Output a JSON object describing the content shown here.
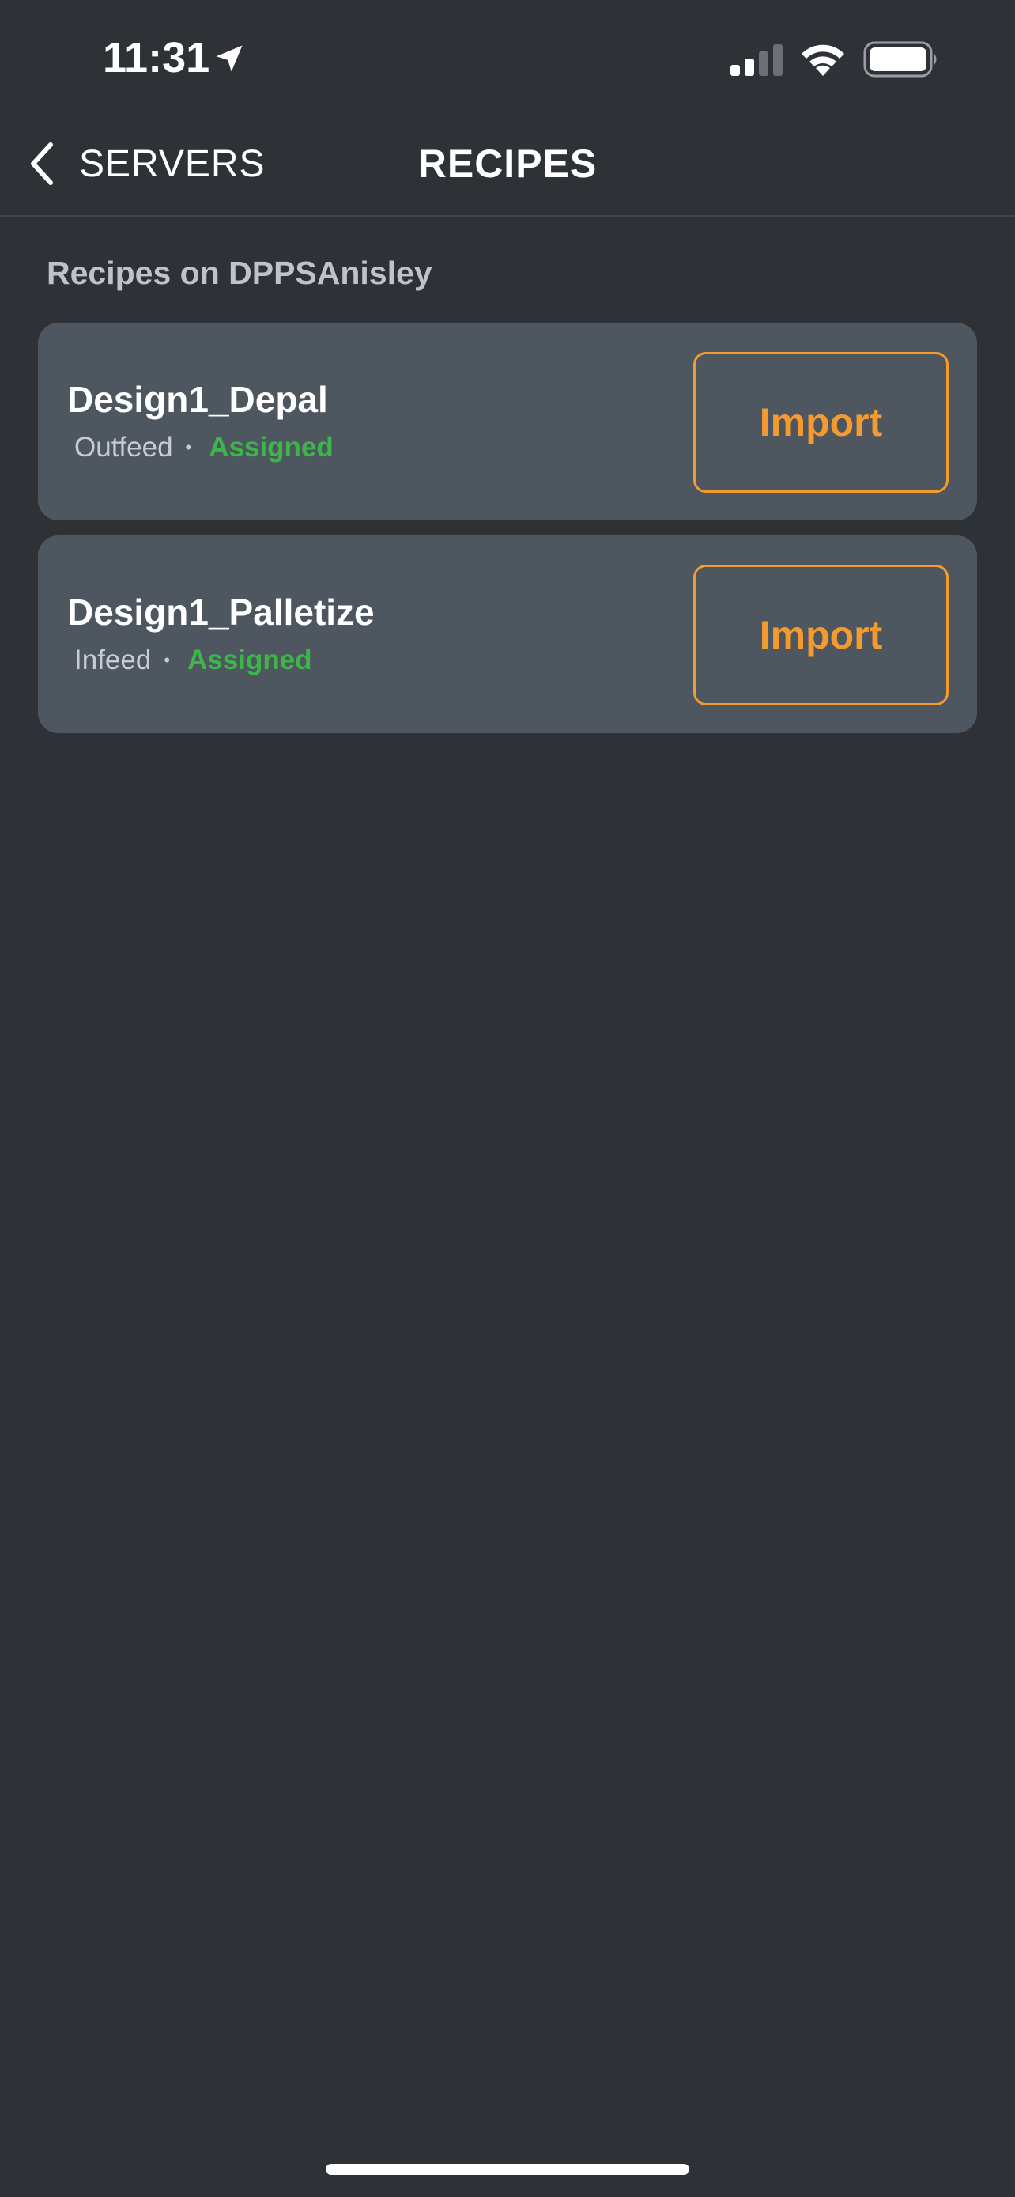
{
  "status_bar": {
    "time": "11:31",
    "icons": [
      "location-arrow-icon",
      "signal-icon",
      "wifi-icon",
      "battery-icon"
    ]
  },
  "nav": {
    "back_label": "SERVERS",
    "title": "RECIPES"
  },
  "section": {
    "header": "Recipes on DPPSAnisley"
  },
  "recipes": [
    {
      "name": "Design1_Depal",
      "feed": "Outfeed",
      "separator": "•",
      "status": "Assigned",
      "button_label": "Import"
    },
    {
      "name": "Design1_Palletize",
      "feed": "Infeed",
      "separator": "•",
      "status": "Assigned",
      "button_label": "Import"
    }
  ],
  "colors": {
    "background": "#2e3237",
    "card": "#4e5760",
    "accent": "#f49b2f",
    "status_assigned": "#3db54a",
    "section_header": "#bfc3c8"
  }
}
